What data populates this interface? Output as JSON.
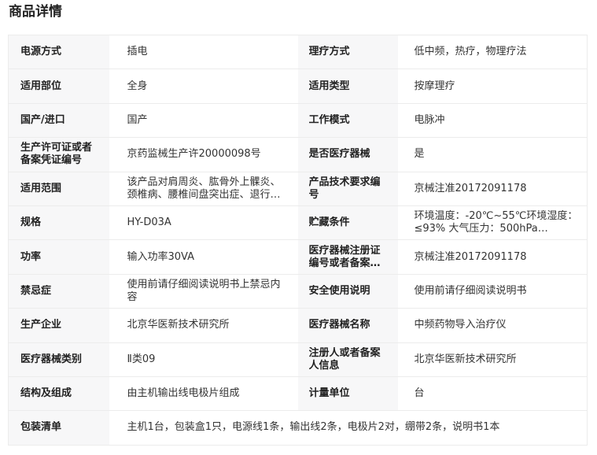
{
  "page": {
    "title": "商品详情"
  },
  "rows": [
    {
      "k1": "电源方式",
      "v1": "插电",
      "k2": "理疗方式",
      "v2": "低中频，热疗，物理疗法"
    },
    {
      "k1": "适用部位",
      "v1": "全身",
      "k2": "适用类型",
      "v2": "按摩理疗"
    },
    {
      "k1": "国产/进口",
      "v1": "国产",
      "k2": "工作模式",
      "v2": "电脉冲"
    },
    {
      "k1": "生产许可证或者备案凭证编号",
      "v1": "京药监械生产许20000098号",
      "k2": "是否医疗器械",
      "v2": "是"
    },
    {
      "k1": "适用范围",
      "v1": "该产品对肩周炎、肱骨外上髁炎、颈椎病、腰椎间盘突出症、退行…",
      "k2": "产品技术要求编号",
      "v2": "京械注准20172091178"
    },
    {
      "k1": "规格",
      "v1": "HY-D03A",
      "k2": "贮藏条件",
      "v2": "环境温度：-20℃~55℃环境湿度：≤93% 大气压力：500hPa…"
    },
    {
      "k1": "功率",
      "v1": "输入功率30VA",
      "k2": "医疗器械注册证编号或者备案…",
      "v2": "京械注准20172091178"
    },
    {
      "k1": "禁忌症",
      "v1": "使用前请仔细阅读说明书上禁忌内容",
      "k2": "安全使用说明",
      "v2": "使用前请仔细阅读说明书"
    },
    {
      "k1": "生产企业",
      "v1": "北京华医新技术研究所",
      "k2": "医疗器械名称",
      "v2": "中频药物导入治疗仪"
    },
    {
      "k1": "医疗器械类别",
      "v1": "Ⅱ类09",
      "k2": "注册人或者备案人信息",
      "v2": "北京华医新技术研究所"
    },
    {
      "k1": "结构及组成",
      "v1": "由主机输出线电极片组成",
      "k2": "计量单位",
      "v2": "台"
    }
  ],
  "last_row": {
    "k": "包装清单",
    "v": "主机1台，包装盒1只，电源线1条，输出线2条，电极片2对，绷带2条，说明书1本"
  },
  "colors": {
    "label_bg": "#f7f7f8",
    "value_bg": "#ffffff",
    "border": "#ececec"
  }
}
